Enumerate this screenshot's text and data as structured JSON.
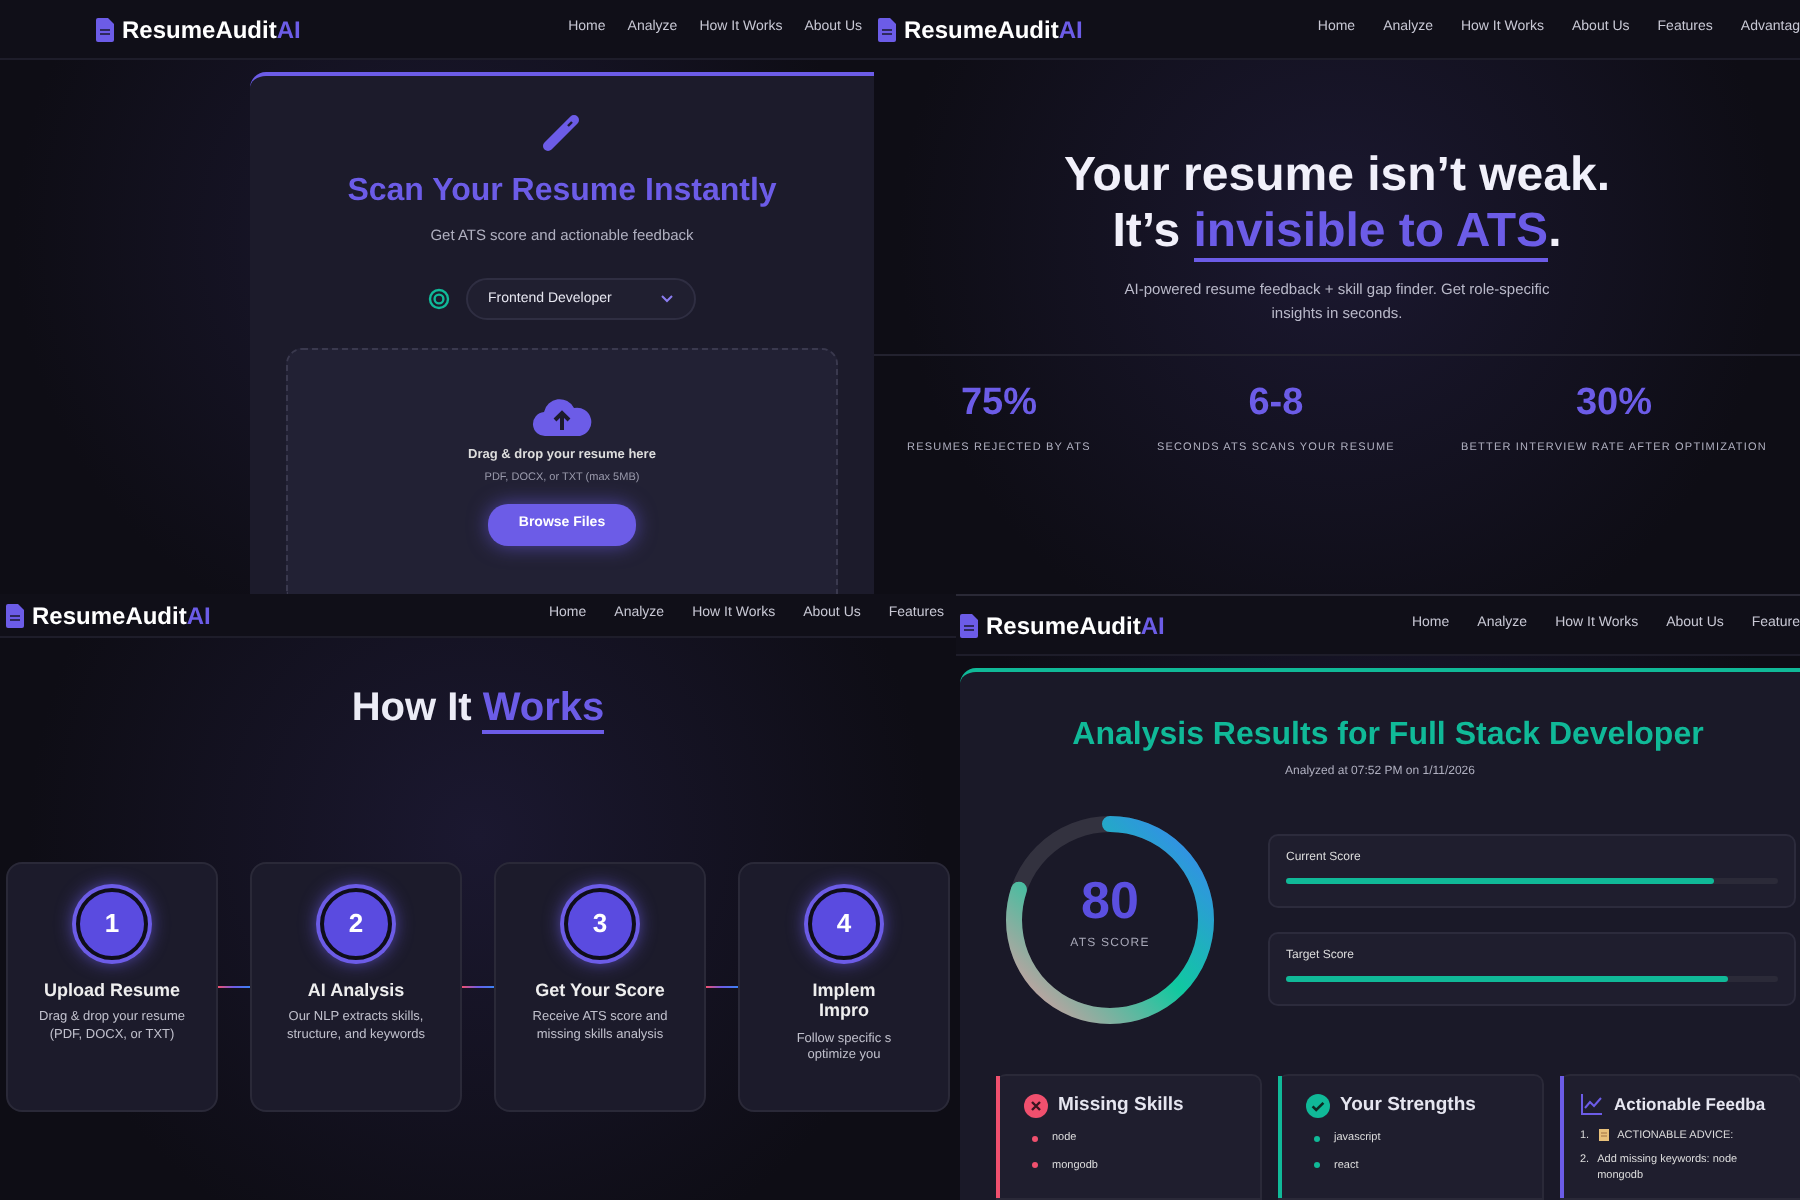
{
  "screens": [
    {
      "kind": "scan",
      "nav": {
        "brand": "ResumeAudit",
        "brand_accent": "AI",
        "links": [
          "Home",
          "Analyze",
          "How It Works",
          "About Us"
        ]
      },
      "title": "Scan Your Resume Instantly",
      "subtitle": "Get ATS score and actionable feedback",
      "role_select": {
        "value": "Frontend Developer"
      },
      "dropzone": {
        "heading": "Drag & drop your resume here",
        "hint": "PDF, DOCX, or TXT (max 5MB)",
        "button": "Browse Files"
      }
    },
    {
      "kind": "hero",
      "nav": {
        "brand": "ResumeAudit",
        "brand_accent": "AI",
        "links": [
          "Home",
          "Analyze",
          "How It Works",
          "About Us",
          "Features",
          "Advantag"
        ]
      },
      "headline": "Your resume isn’t weak.",
      "headline_2": {
        "before": "It’s ",
        "accent": "invisible to ATS",
        "after": "."
      },
      "subtitle": "AI-powered resume feedback + skill gap finder. Get role-specific insights in seconds.",
      "stats": [
        {
          "value": "75%",
          "label": "RESUMES REJECTED BY ATS"
        },
        {
          "value": "6-8",
          "label": "SECONDS ATS SCANS YOUR RESUME"
        },
        {
          "value": "30%",
          "label": "BETTER INTERVIEW RATE AFTER OPTIMIZATION"
        }
      ]
    },
    {
      "kind": "steps",
      "nav": {
        "brand": "ResumeAudit",
        "brand_accent": "AI",
        "links": [
          "Home",
          "Analyze",
          "How It Works",
          "About Us",
          "Features"
        ]
      },
      "title": {
        "before": "How It ",
        "accent": "Works"
      },
      "steps": [
        {
          "number": "1",
          "title": "Upload Resume",
          "text": "Drag & drop your resume\n(PDF, DOCX, or TXT)"
        },
        {
          "number": "2",
          "title": "AI Analysis",
          "text": "Our NLP extracts skills,\nstructure, and keywords"
        },
        {
          "number": "3",
          "title": "Get Your Score",
          "text": "Receive ATS score and\nmissing skills analysis"
        },
        {
          "number": "4",
          "title": "Implem\nImpro",
          "text": "Follow specific s\noptimize you"
        }
      ]
    },
    {
      "kind": "results",
      "nav": {
        "brand": "ResumeAudit",
        "brand_accent": "AI",
        "links": [
          "Home",
          "Analyze",
          "How It Works",
          "About Us",
          "Feature"
        ]
      },
      "title": "Analysis Results for Full Stack Developer",
      "analyzed": "Analyzed at 07:52 PM on 1/11/2026",
      "score": {
        "value": "80",
        "label": "ATS SCORE",
        "level": 0.8
      },
      "bars": [
        {
          "label": "Current Score",
          "level": 0.87
        },
        {
          "label": "Target Score",
          "level": 0.9
        }
      ],
      "cards": [
        {
          "kind": "missing",
          "title": "Missing Skills",
          "color": "#f0506e",
          "items": [
            "node",
            "mongodb"
          ]
        },
        {
          "kind": "strengths",
          "title": "Your Strengths",
          "color": "#10b998",
          "items": [
            "javascript",
            "react"
          ]
        },
        {
          "kind": "feedback",
          "title": "Actionable Feedba",
          "color": "#6c5ce7",
          "items": [
            {
              "number": "1.",
              "text": "ACTIONABLE ADVICE:"
            },
            {
              "number": "2.",
              "text": "Add missing keywords: node\nmongodb"
            }
          ]
        }
      ]
    }
  ]
}
